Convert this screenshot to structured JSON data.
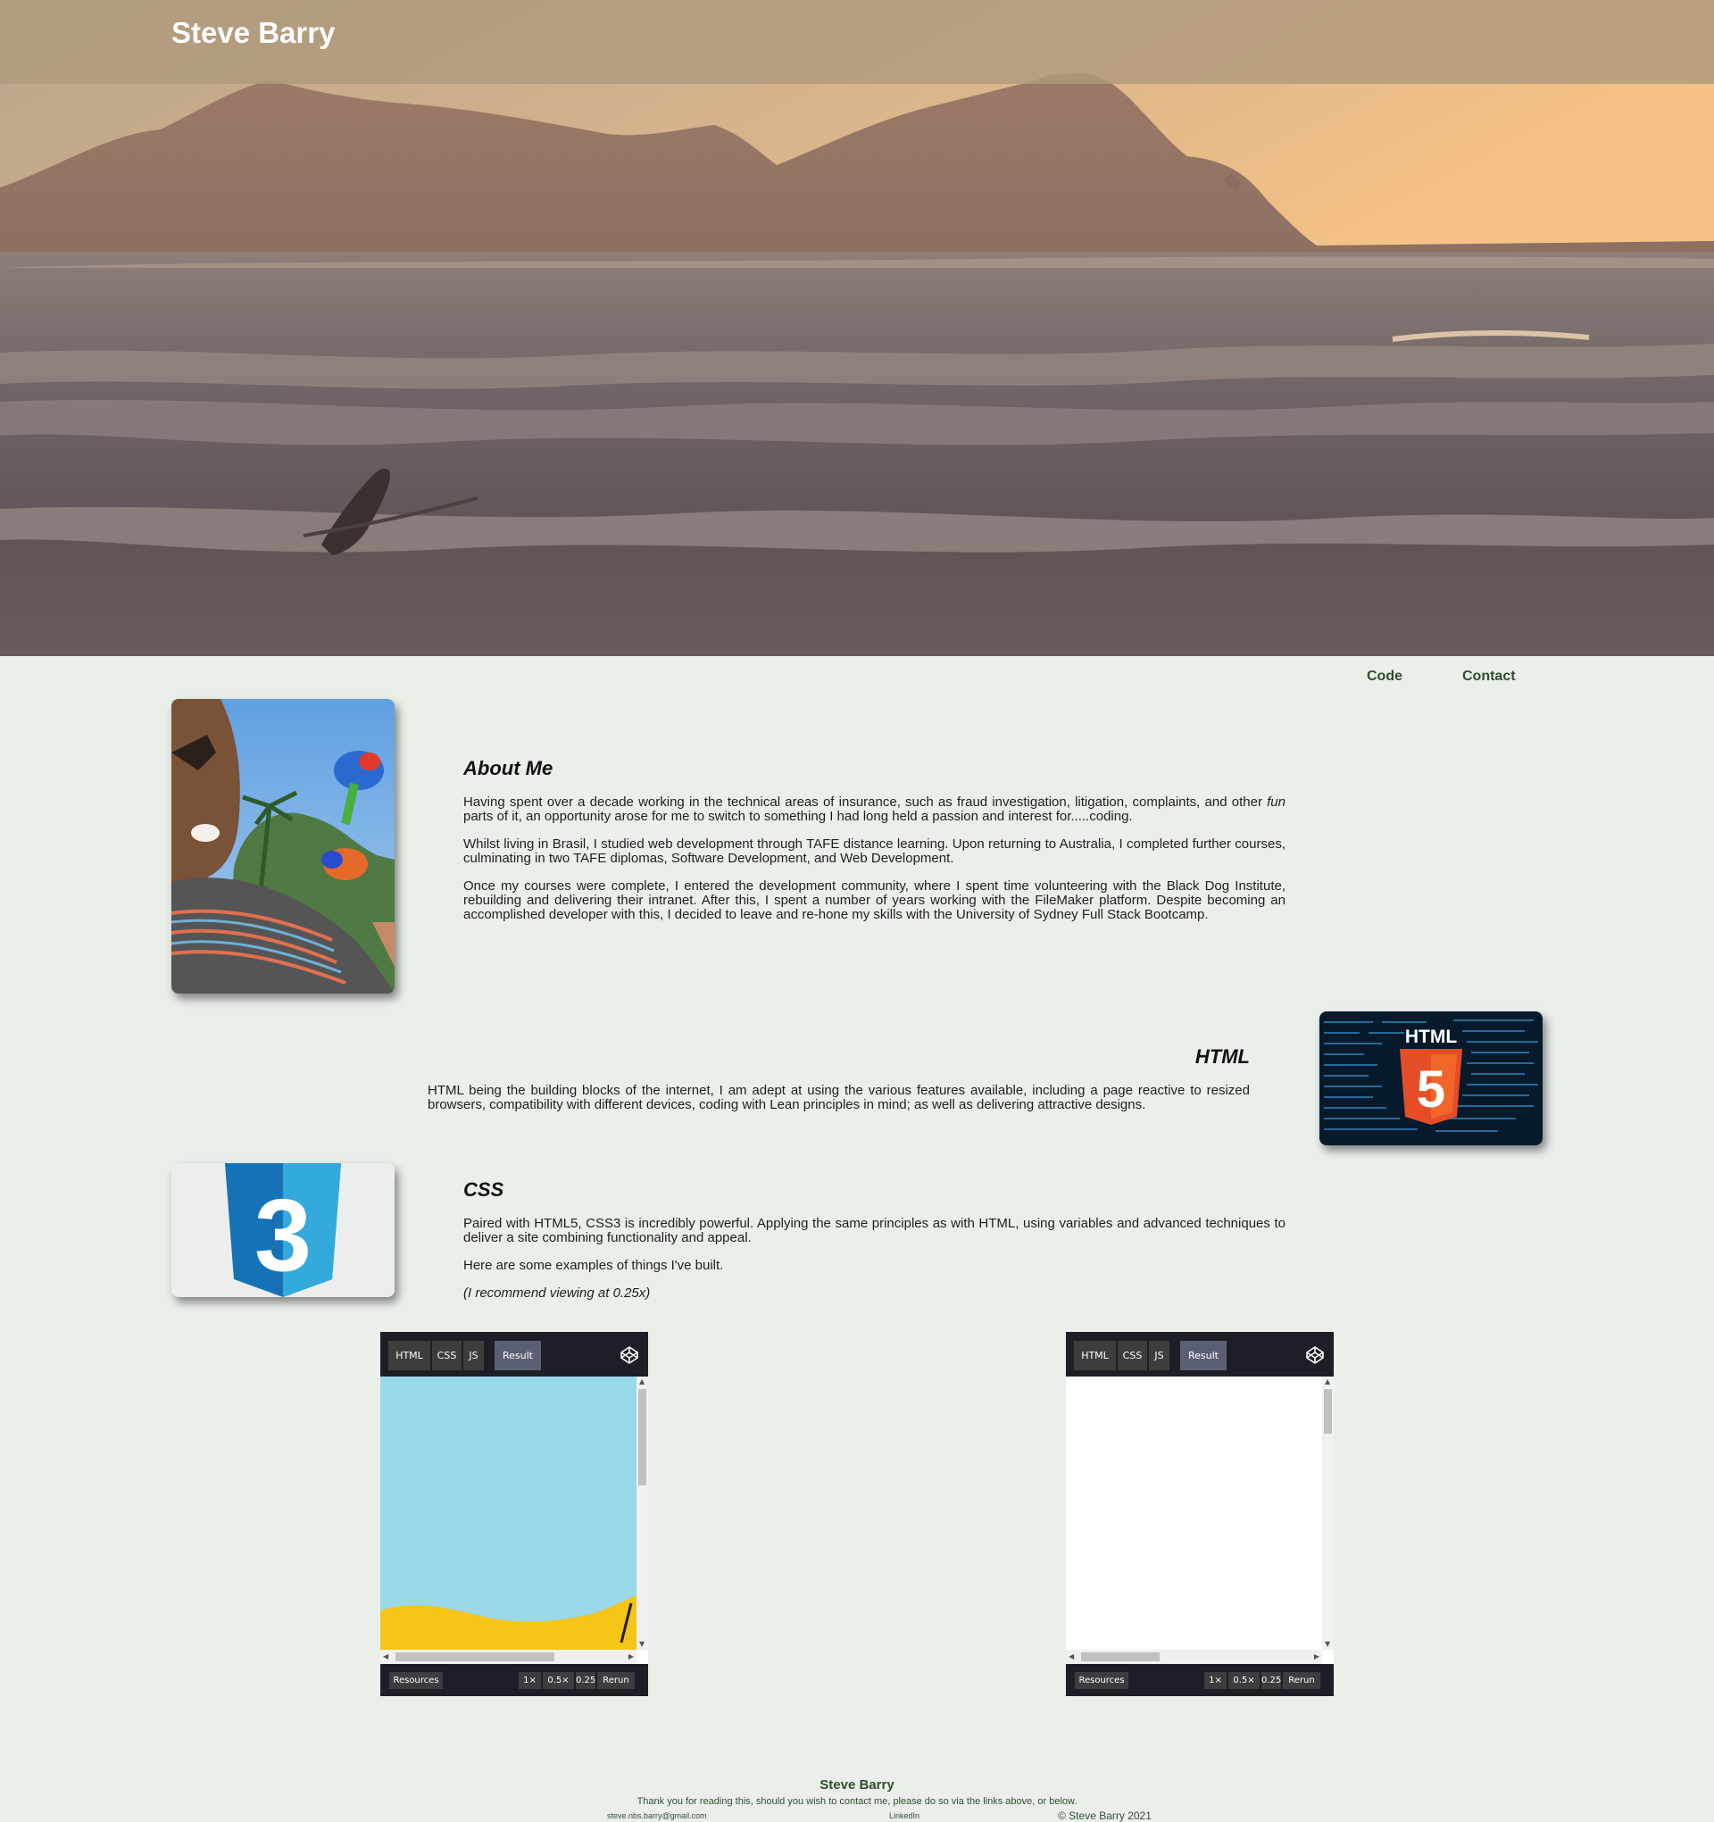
{
  "header": {
    "title": "Steve Barry"
  },
  "nav": {
    "items": [
      {
        "label": "Code"
      },
      {
        "label": "Contact"
      }
    ]
  },
  "about": {
    "title": "About Me",
    "p1_before": "Having spent over a decade working in the technical areas of insurance, such as fraud investigation, litigation, complaints, and other ",
    "p1_em": "fun",
    "p1_after": " parts of it, an opportunity arose for me to switch to something I had long held a passion and interest for.....coding.",
    "p2": "Whilst living in Brasil, I studied web development through TAFE distance learning. Upon returning to Australia, I completed further courses, culminating in two TAFE diplomas, Software Development, and Web Development.",
    "p3": "Once my courses were complete, I entered the development community, where I spent time volunteering with the Black Dog Institute, rebuilding and delivering their intranet. After this, I spent a number of years working with the FileMaker platform. Despite becoming an accomplished developer with this, I decided to leave and re-hone my skills with the University of Sydney Full Stack Bootcamp."
  },
  "html_section": {
    "title": "HTML",
    "p1": "HTML being the building blocks of the internet, I am adept at using the various features available, including a page reactive to resized browsers, compatibility with different devices, coding with Lean principles in mind; as well as delivering attractive designs.",
    "logo_text": "HTML",
    "logo_number": "5"
  },
  "css_section": {
    "title": "CSS",
    "p1": "Paired with HTML5, CSS3 is incredibly powerful. Applying the same principles as with HTML, using variables and advanced techniques to deliver a site combining functionality and appeal.",
    "p2": "Here are some examples of things I've built.",
    "p3": "(I recommend viewing at 0.25x)",
    "logo_number": "3"
  },
  "embeds": [
    {
      "tabs": [
        "HTML",
        "CSS",
        "JS",
        "Result"
      ],
      "resources": "Resources",
      "zoom": [
        "1×",
        "0.5×",
        "0.25×"
      ],
      "rerun": "Rerun"
    },
    {
      "tabs": [
        "HTML",
        "CSS",
        "JS",
        "Result"
      ],
      "resources": "Resources",
      "zoom": [
        "1×",
        "0.5×",
        "0.25×"
      ],
      "rerun": "Rerun"
    }
  ],
  "footer": {
    "title": "Steve Barry",
    "message": "Thank you for reading this, should you wish to contact me, please do so via the links above, or below.",
    "email": "steve.nbs.barry@gmail.com",
    "linkedin": "LinkedIn",
    "copyright": "© Steve Barry 2021"
  },
  "colors": {
    "page_bg": "#ebefea",
    "header_bar": "#b09a7c",
    "accent_green": "#2f4f2f",
    "html5_orange": "#e44d26",
    "css3_blue": "#1572b6",
    "embed_dark": "#1e1f26"
  }
}
